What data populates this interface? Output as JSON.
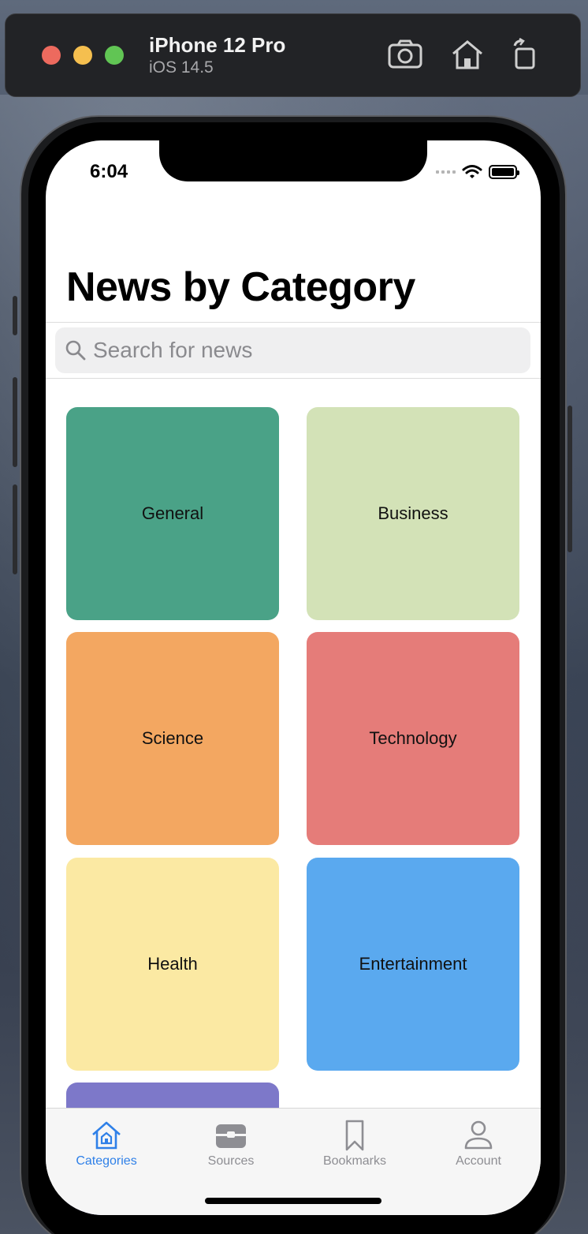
{
  "simulator": {
    "device_name": "iPhone 12 Pro",
    "os_version": "iOS 14.5",
    "icons": [
      "camera-icon",
      "home-icon",
      "rotate-icon"
    ]
  },
  "status_bar": {
    "time": "6:04",
    "icons": [
      "cellular-signal-icon",
      "wifi-icon",
      "battery-icon"
    ]
  },
  "header": {
    "title": "News by Category"
  },
  "search": {
    "placeholder": "Search for news",
    "value": ""
  },
  "categories": [
    {
      "label": "General",
      "color": "#4aa287"
    },
    {
      "label": "Business",
      "color": "#d3e2b7"
    },
    {
      "label": "Science",
      "color": "#f3a761"
    },
    {
      "label": "Technology",
      "color": "#e57c79"
    },
    {
      "label": "Health",
      "color": "#fbe9a3"
    },
    {
      "label": "Entertainment",
      "color": "#5aa9ef"
    },
    {
      "label": "",
      "color": "#7d78c9"
    }
  ],
  "tab_bar": {
    "active_color": "#2f80e8",
    "inactive_color": "#8e8e93",
    "tabs": [
      {
        "label": "Categories",
        "icon": "house-icon",
        "active": true
      },
      {
        "label": "Sources",
        "icon": "tray-icon",
        "active": false
      },
      {
        "label": "Bookmarks",
        "icon": "bookmark-icon",
        "active": false
      },
      {
        "label": "Account",
        "icon": "person-icon",
        "active": false
      }
    ]
  }
}
